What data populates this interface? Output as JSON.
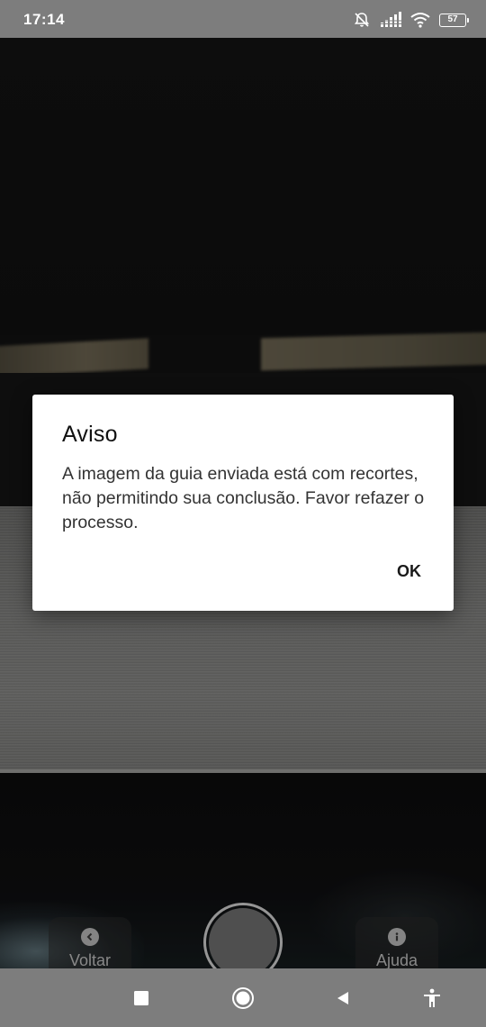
{
  "status_bar": {
    "time": "17:14",
    "battery_level": "57",
    "icons": [
      "alarm-off-icon",
      "signal-icon",
      "wifi-icon",
      "battery-icon"
    ]
  },
  "dialog": {
    "title": "Aviso",
    "message": "A imagem da guia enviada está com recortes, não permitindo sua conclusão. Favor refazer o processo.",
    "ok_label": "OK"
  },
  "camera_controls": {
    "back_label": "Voltar",
    "back_icon": "chevron-left-icon",
    "help_label": "Ajuda",
    "help_icon": "info-icon",
    "shutter_icon": "shutter-button"
  },
  "nav_bar": {
    "buttons": [
      "recents-icon",
      "home-icon",
      "back-icon",
      "accessibility-icon"
    ]
  },
  "colors": {
    "system_bar": "#7d7d7d",
    "dialog_background": "#ffffff",
    "dialog_text": "#333333"
  }
}
